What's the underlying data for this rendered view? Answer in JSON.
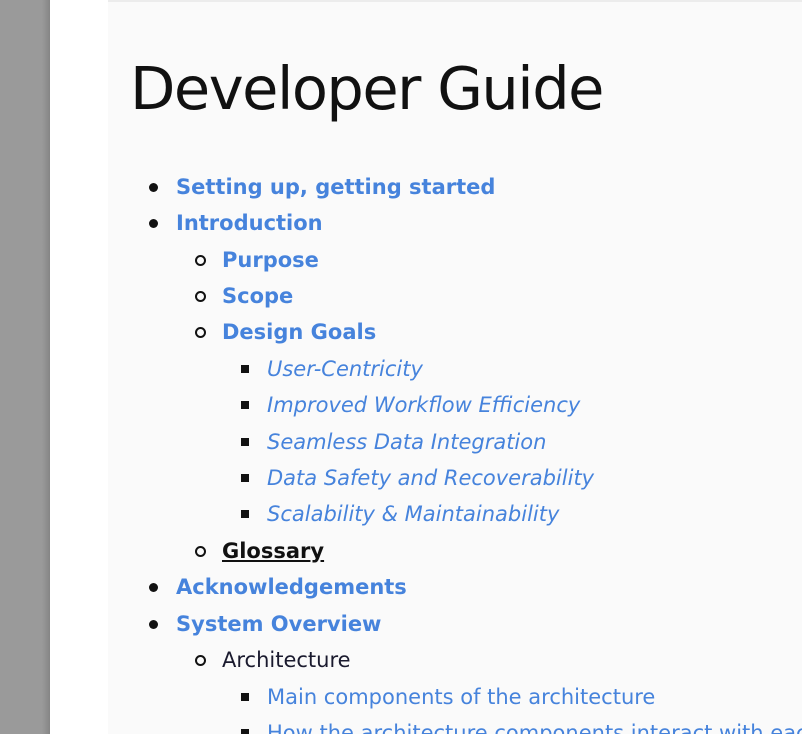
{
  "page": {
    "title": "Developer Guide"
  },
  "toc": {
    "setting_up": "Setting up, getting started",
    "introduction": "Introduction",
    "purpose": "Purpose",
    "scope": "Scope",
    "design_goals": "Design Goals",
    "goals": [
      "User-Centricity",
      "Improved Workflow Efficiency",
      "Seamless Data Integration",
      "Data Safety and Recoverability",
      "Scalability & Maintainability"
    ],
    "glossary": "Glossary",
    "acknowledgements": "Acknowledgements",
    "system_overview": "System Overview",
    "architecture": "Architecture",
    "architecture_items": [
      "Main components of the architecture",
      "How the architecture components interact with each other"
    ]
  },
  "colors": {
    "link": "#4683dc",
    "text": "#111111",
    "background": "#fafafa",
    "gutter": "#9b9b9b"
  }
}
